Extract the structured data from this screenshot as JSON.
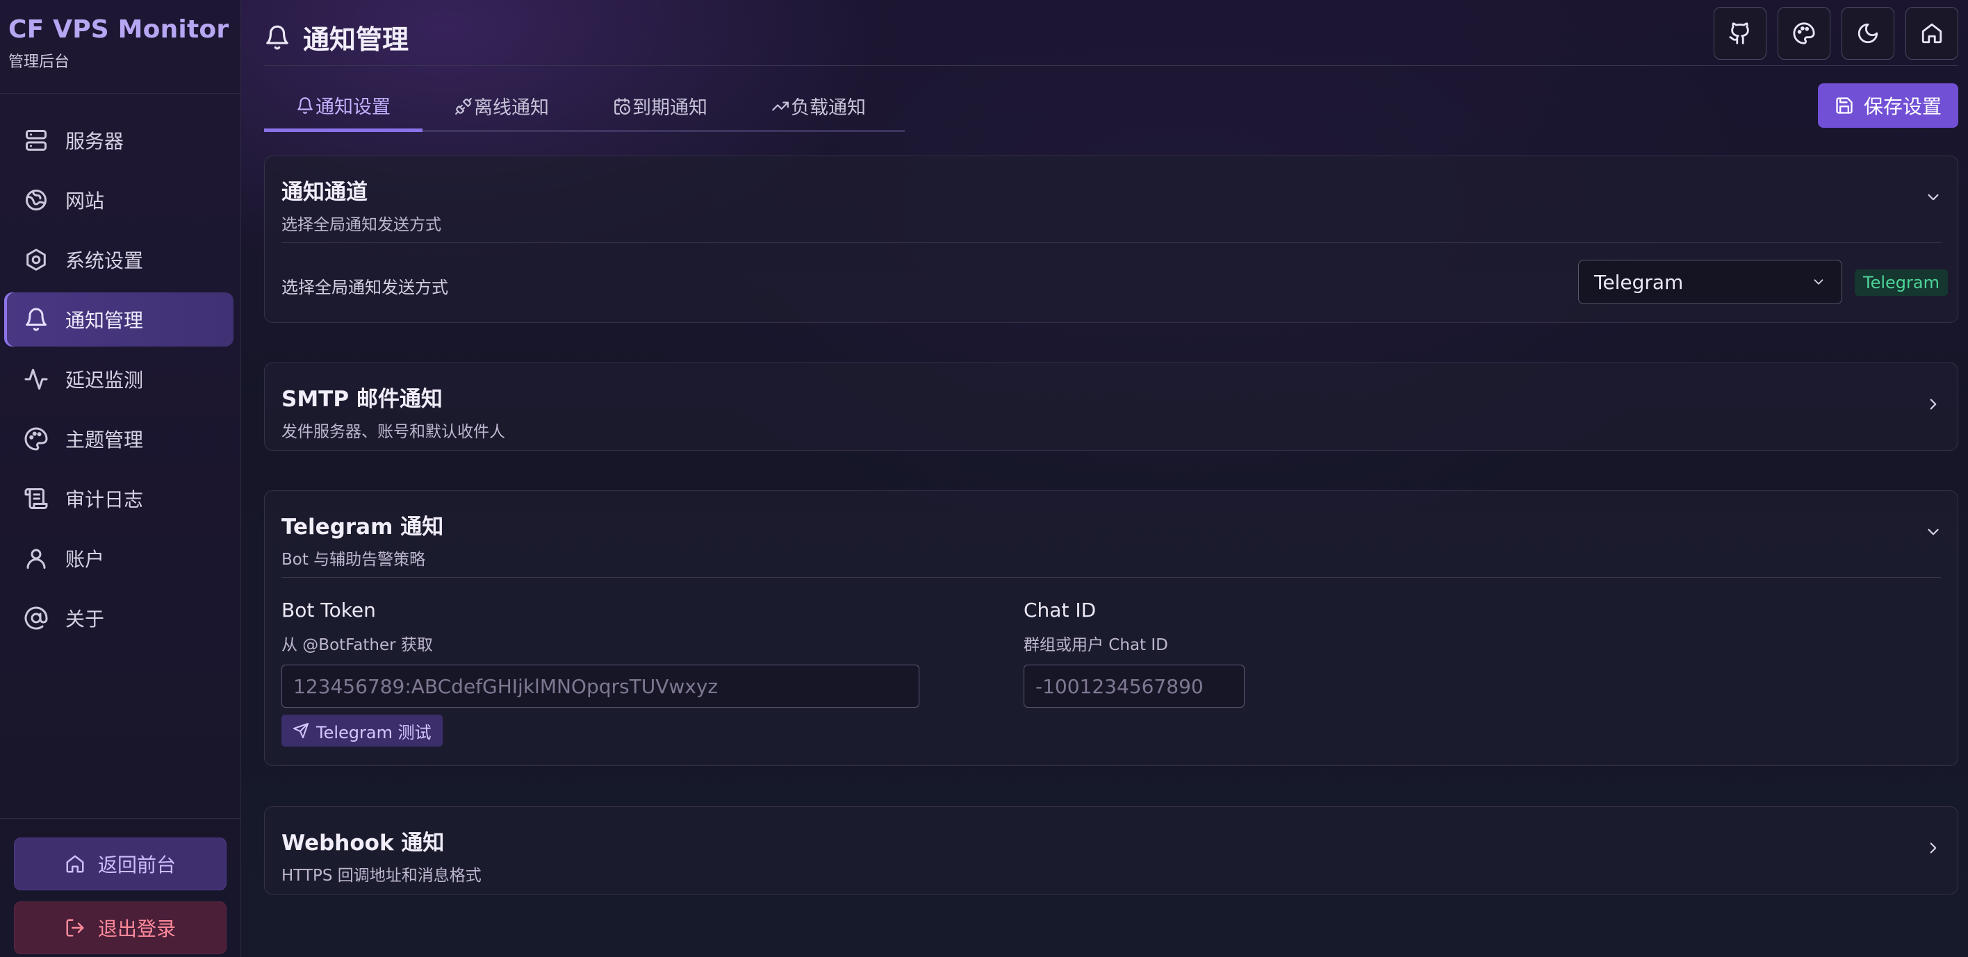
{
  "sidebar": {
    "brand_title": "CF VPS Monitor",
    "brand_subtitle": "管理后台",
    "items": [
      {
        "label": "服务器",
        "icon": "server-icon"
      },
      {
        "label": "网站",
        "icon": "globe-icon"
      },
      {
        "label": "系统设置",
        "icon": "settings-icon"
      },
      {
        "label": "通知管理",
        "icon": "bell-icon",
        "active": true
      },
      {
        "label": "延迟监测",
        "icon": "activity-icon"
      },
      {
        "label": "主题管理",
        "icon": "palette-icon"
      },
      {
        "label": "审计日志",
        "icon": "scroll-icon"
      },
      {
        "label": "账户",
        "icon": "user-icon"
      },
      {
        "label": "关于",
        "icon": "at-sign-icon"
      }
    ],
    "home_button": "返回前台",
    "logout_button": "退出登录"
  },
  "header": {
    "title": "通知管理",
    "actions": [
      "github-icon",
      "palette-icon",
      "moon-icon",
      "home-icon"
    ]
  },
  "tabs": [
    {
      "label": "通知设置",
      "icon": "bell-icon",
      "active": true
    },
    {
      "label": "离线通知",
      "icon": "unplug-icon"
    },
    {
      "label": "到期通知",
      "icon": "calendar-clock-icon"
    },
    {
      "label": "负载通知",
      "icon": "trending-up-icon"
    }
  ],
  "save_button": "保存设置",
  "channel_card": {
    "title": "通知通道",
    "subtitle": "选择全局通知发送方式",
    "row_label": "选择全局通知发送方式",
    "selected": "Telegram",
    "badge": "Telegram"
  },
  "smtp_card": {
    "title": "SMTP 邮件通知",
    "subtitle": "发件服务器、账号和默认收件人"
  },
  "telegram_card": {
    "title": "Telegram 通知",
    "subtitle": "Bot 与辅助告警策略",
    "bot_token": {
      "label": "Bot Token",
      "hint": "从 @BotFather 获取",
      "placeholder": "123456789:ABCdefGHIjklMNOpqrsTUVwxyz"
    },
    "chat_id": {
      "label": "Chat ID",
      "hint": "群组或用户 Chat ID",
      "placeholder": "-1001234567890"
    },
    "test_button": "Telegram 测试"
  },
  "webhook_card": {
    "title": "Webhook 通知",
    "subtitle": "HTTPS 回调地址和消息格式"
  },
  "colors": {
    "accent": "#7250d6",
    "brand": "#b7a6f2",
    "success_badge": "#4ed59b",
    "danger": "#ff8a9c"
  }
}
